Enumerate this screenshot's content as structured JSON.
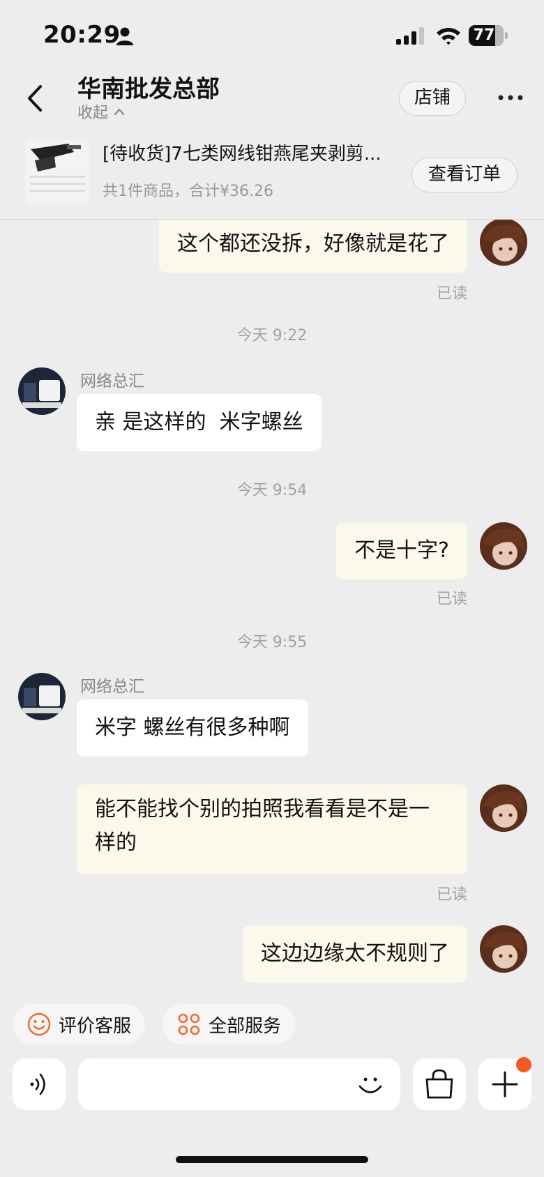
{
  "status_bar": {
    "time": "20:29",
    "battery": "77"
  },
  "header": {
    "title": "华南批发总部",
    "collapse_label": "收起",
    "store_button": "店铺"
  },
  "order": {
    "title": "[待收货]7七类网线钳燕尾夹剥剪...",
    "summary": "共1件商品，合计¥36.26",
    "view_button": "查看订单"
  },
  "messages": [
    {
      "from": "me",
      "text": "这个都还没拆，好像就是花了",
      "read": "已读"
    },
    {
      "type": "time",
      "text": "今天 9:22"
    },
    {
      "from": "them",
      "sender": "网络总汇",
      "text": "亲 是这样的  米字螺丝"
    },
    {
      "type": "time",
      "text": "今天 9:54"
    },
    {
      "from": "me",
      "text": "不是十字?",
      "read": "已读"
    },
    {
      "type": "time",
      "text": "今天 9:55"
    },
    {
      "from": "them",
      "sender": "网络总汇",
      "text": "米字 螺丝有很多种啊"
    },
    {
      "from": "me",
      "text": "能不能找个别的拍照我看看是不是一样的",
      "read": "已读"
    },
    {
      "from": "me",
      "text": "这边边缘太不规则了"
    }
  ],
  "quick_actions": [
    {
      "label": "评价客服",
      "icon": "smile-icon"
    },
    {
      "label": "全部服务",
      "icon": "grid-icon"
    }
  ],
  "input": {
    "placeholder": ""
  },
  "colors": {
    "accent": "#f06a2a",
    "me_bubble": "#fcf8ec",
    "them_bubble": "#ffffff",
    "background": "#ededed",
    "badge": "#f35a23"
  }
}
